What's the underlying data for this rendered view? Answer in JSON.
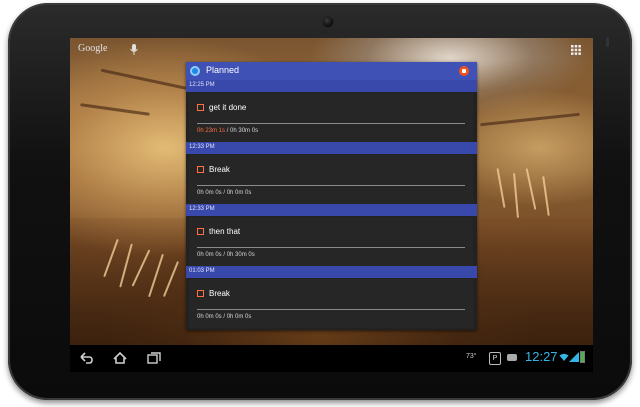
{
  "launcher": {
    "google_label": "Google"
  },
  "widget": {
    "title": "Planned",
    "tasks": [
      {
        "time": "12:25 PM",
        "name": "get it done",
        "elapsed": "0h 23m 1s",
        "separator": "/",
        "planned": "0h 30m 0s",
        "active": true
      },
      {
        "time": "12:33 PM",
        "name": "Break",
        "elapsed": "0h 0m 0s",
        "separator": "/",
        "planned": "0h 0m 0s",
        "active": false
      },
      {
        "time": "12:33 PM",
        "name": "then that",
        "elapsed": "0h 0m 0s",
        "separator": "/",
        "planned": "0h 30m 0s",
        "active": false
      },
      {
        "time": "01:03 PM",
        "name": "Break",
        "elapsed": "0h 0m 0s",
        "separator": "/",
        "planned": "0h 0m 0s",
        "active": false
      }
    ]
  },
  "status_bar": {
    "temperature": "73°",
    "parking_label": "P",
    "clock": "12:27"
  },
  "colors": {
    "header": "#3f51b5",
    "time_bar": "#3949ab",
    "accent": "#ff7043",
    "clock": "#33b5e5"
  },
  "icons": [
    "mic-icon",
    "apps-grid-icon",
    "back-icon",
    "home-icon",
    "recent-apps-icon",
    "record-icon",
    "wifi-icon",
    "signal-icon",
    "battery-icon"
  ]
}
